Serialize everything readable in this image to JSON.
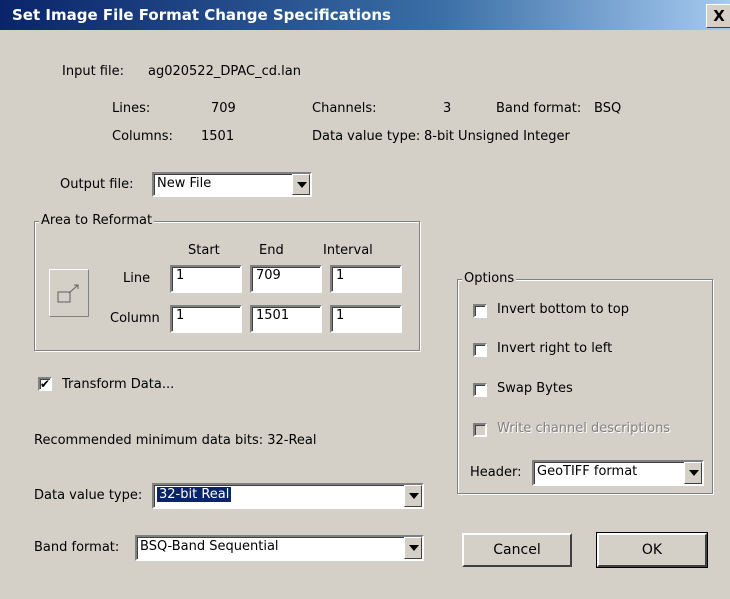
{
  "window": {
    "title": "Set Image File Format Change Specifications",
    "close_label": "X"
  },
  "input": {
    "label": "Input file:",
    "filename": "ag020522_DPAC_cd.lan"
  },
  "info": {
    "lines_label": "Lines:",
    "lines_value": "709",
    "columns_label": "Columns:",
    "columns_value": "1501",
    "channels_label": "Channels:",
    "channels_value": "3",
    "data_type_label": "Data value type:",
    "data_type_value": "8-bit Unsigned Integer",
    "band_format_label": "Band format:",
    "band_format_value": "BSQ"
  },
  "output": {
    "label": "Output file:",
    "value": "New File"
  },
  "area": {
    "legend": "Area to Reformat",
    "start_header": "Start",
    "end_header": "End",
    "interval_header": "Interval",
    "line_label": "Line",
    "line_start": "1",
    "line_end": "709",
    "line_interval": "1",
    "column_label": "Column",
    "column_start": "1",
    "column_end": "1501",
    "column_interval": "1"
  },
  "transform": {
    "label": "Transform Data...",
    "checked": true,
    "check_mark": "✔"
  },
  "recommended": "Recommended minimum data bits: 32-Real",
  "data_value_type": {
    "label": "Data value type:",
    "value": "32-bit Real"
  },
  "band_format": {
    "label": "Band format:",
    "value": "BSQ-Band Sequential"
  },
  "options": {
    "legend": "Options",
    "invert_bottom_top": "Invert bottom to top",
    "invert_right_left": "Invert right to left",
    "swap_bytes": "Swap Bytes",
    "write_channel_desc": "Write channel descriptions",
    "header_label": "Header:",
    "header_value": "GeoTIFF format"
  },
  "buttons": {
    "cancel": "Cancel",
    "ok": "OK"
  },
  "colors": {
    "dialog_bg": "#d4d0c8",
    "title_start": "#0a246a",
    "title_end": "#a6caf0",
    "selection": "#0a246a"
  }
}
